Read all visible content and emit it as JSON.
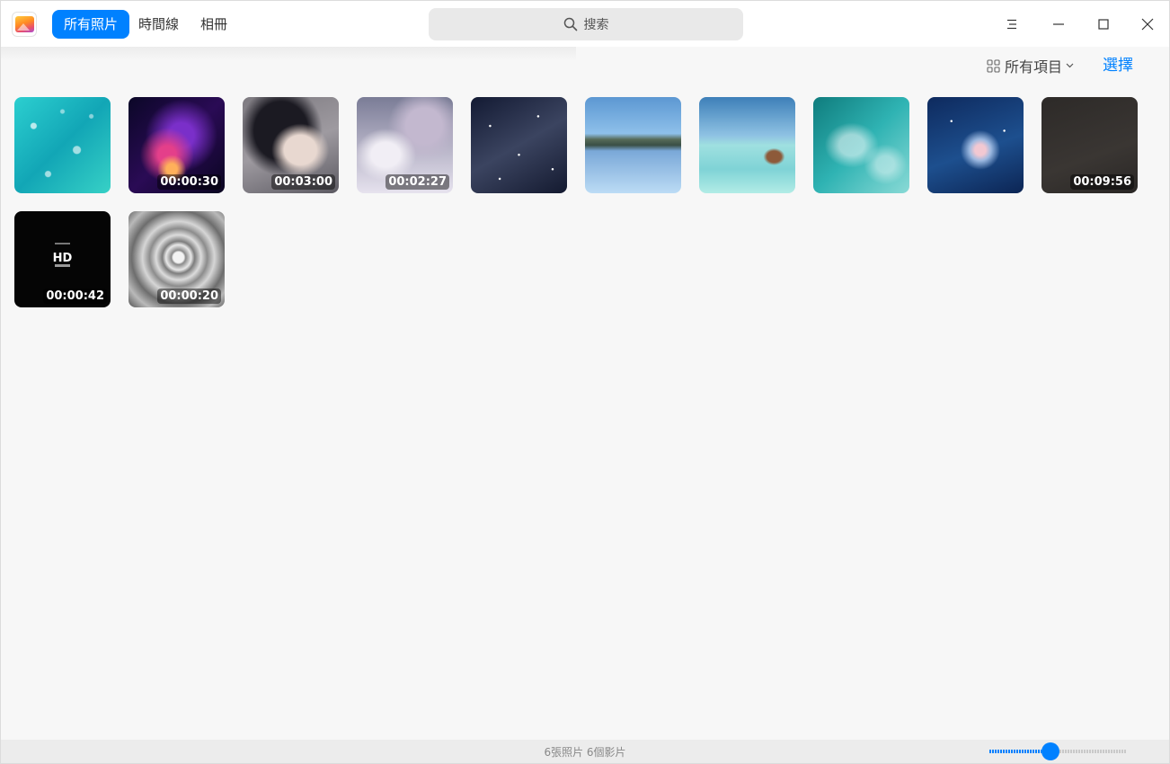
{
  "titlebar": {
    "tabs": [
      {
        "label": "所有照片",
        "active": true
      },
      {
        "label": "時間線",
        "active": false
      },
      {
        "label": "相冊",
        "active": false
      }
    ],
    "search_placeholder": "搜索",
    "window_controls": [
      "menu-icon",
      "minimize-icon",
      "maximize-icon",
      "close-icon"
    ]
  },
  "toolbar": {
    "filter_label": "所有項目",
    "select_label": "選擇"
  },
  "thumbnails": [
    {
      "type": "photo",
      "duration": null,
      "theme": "turquoise-bubbles"
    },
    {
      "type": "video",
      "duration": "00:00:30",
      "theme": "nebula"
    },
    {
      "type": "video",
      "duration": "00:03:00",
      "theme": "anime-girl"
    },
    {
      "type": "video",
      "duration": "00:02:27",
      "theme": "violinist"
    },
    {
      "type": "photo",
      "duration": null,
      "theme": "starry-sky"
    },
    {
      "type": "photo",
      "duration": null,
      "theme": "lake-reflection"
    },
    {
      "type": "photo",
      "duration": null,
      "theme": "beach-huts"
    },
    {
      "type": "photo",
      "duration": null,
      "theme": "ocean-waves"
    },
    {
      "type": "photo",
      "duration": null,
      "theme": "night-cloud"
    },
    {
      "type": "video",
      "duration": "00:09:56",
      "theme": "dark"
    },
    {
      "type": "video",
      "duration": "00:00:42",
      "theme": "hd-club"
    },
    {
      "type": "video",
      "duration": "00:00:20",
      "theme": "water-ripple"
    }
  ],
  "statusbar": {
    "summary": "6張照片 6個影片",
    "zoom_fraction": 0.45
  },
  "colors": {
    "accent": "#0081ff",
    "background": "#f7f7f7"
  }
}
